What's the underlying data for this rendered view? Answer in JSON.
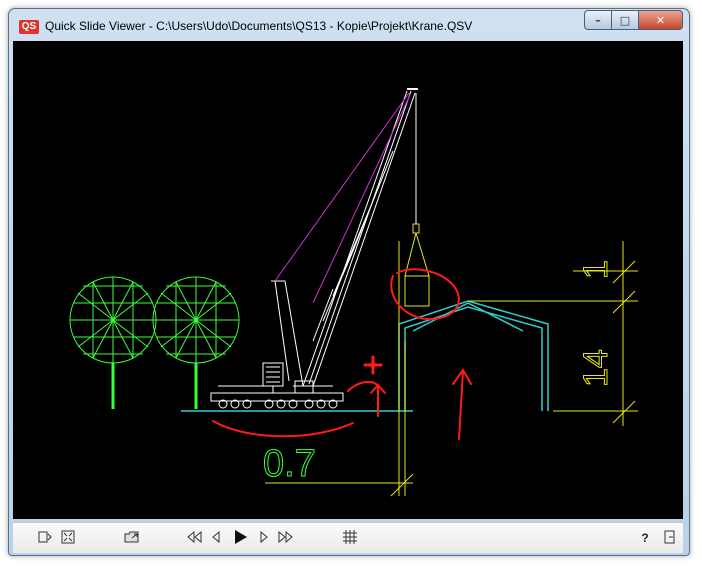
{
  "window": {
    "title": "Quick Slide Viewer - C:\\Users\\Udo\\Documents\\QS13 - Kopie\\Projekt\\Krane.QSV",
    "app_icon_text": "QS"
  },
  "window_controls": {
    "minimize": "–",
    "maximize": "□",
    "close": "✕"
  },
  "drawing": {
    "dim_horizontal": "0.7",
    "dim_height": "14",
    "dim_top": "1",
    "colors": {
      "tree": "#39ff39",
      "crane": "#ffffff",
      "building": "#33cccc",
      "dimension": "#e6e61a",
      "annotation": "#ff1a1a",
      "rope": "#cc33cc"
    }
  },
  "toolbar": {
    "icons": [
      "panel-toggle-icon",
      "fit-view-icon",
      "open-folder-icon",
      "first-slide-icon",
      "previous-slide-icon",
      "play-icon",
      "next-slide-icon",
      "last-slide-icon",
      "grid-icon",
      "help-icon",
      "exit-icon"
    ],
    "help_label": "?"
  }
}
